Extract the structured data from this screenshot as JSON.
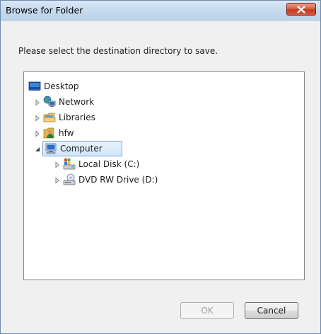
{
  "window": {
    "title": "Browse for Folder",
    "close_icon": "close-x-icon"
  },
  "instruction": "Please select the destination directory to save.",
  "tree": {
    "items": [
      {
        "label": "Desktop",
        "icon": "desktop-icon",
        "level": 0,
        "expander": "none",
        "selected": false
      },
      {
        "label": "Network",
        "icon": "network-icon",
        "level": 1,
        "expander": "collapsed",
        "selected": false
      },
      {
        "label": "Libraries",
        "icon": "libraries-icon",
        "level": 1,
        "expander": "collapsed",
        "selected": false
      },
      {
        "label": "hfw",
        "icon": "user-folder-icon",
        "level": 1,
        "expander": "collapsed",
        "selected": false
      },
      {
        "label": "Computer",
        "icon": "computer-icon",
        "level": 1,
        "expander": "expanded",
        "selected": true
      },
      {
        "label": "Local Disk (C:)",
        "icon": "local-disk-icon",
        "level": 2,
        "expander": "collapsed",
        "selected": false
      },
      {
        "label": "DVD RW Drive (D:)",
        "icon": "dvd-drive-icon",
        "level": 2,
        "expander": "collapsed",
        "selected": false
      }
    ]
  },
  "buttons": {
    "ok_label": "OK",
    "ok_enabled": false,
    "cancel_label": "Cancel"
  },
  "colors": {
    "selection_border": "#7da2ce",
    "close_button": "#c23a22"
  }
}
